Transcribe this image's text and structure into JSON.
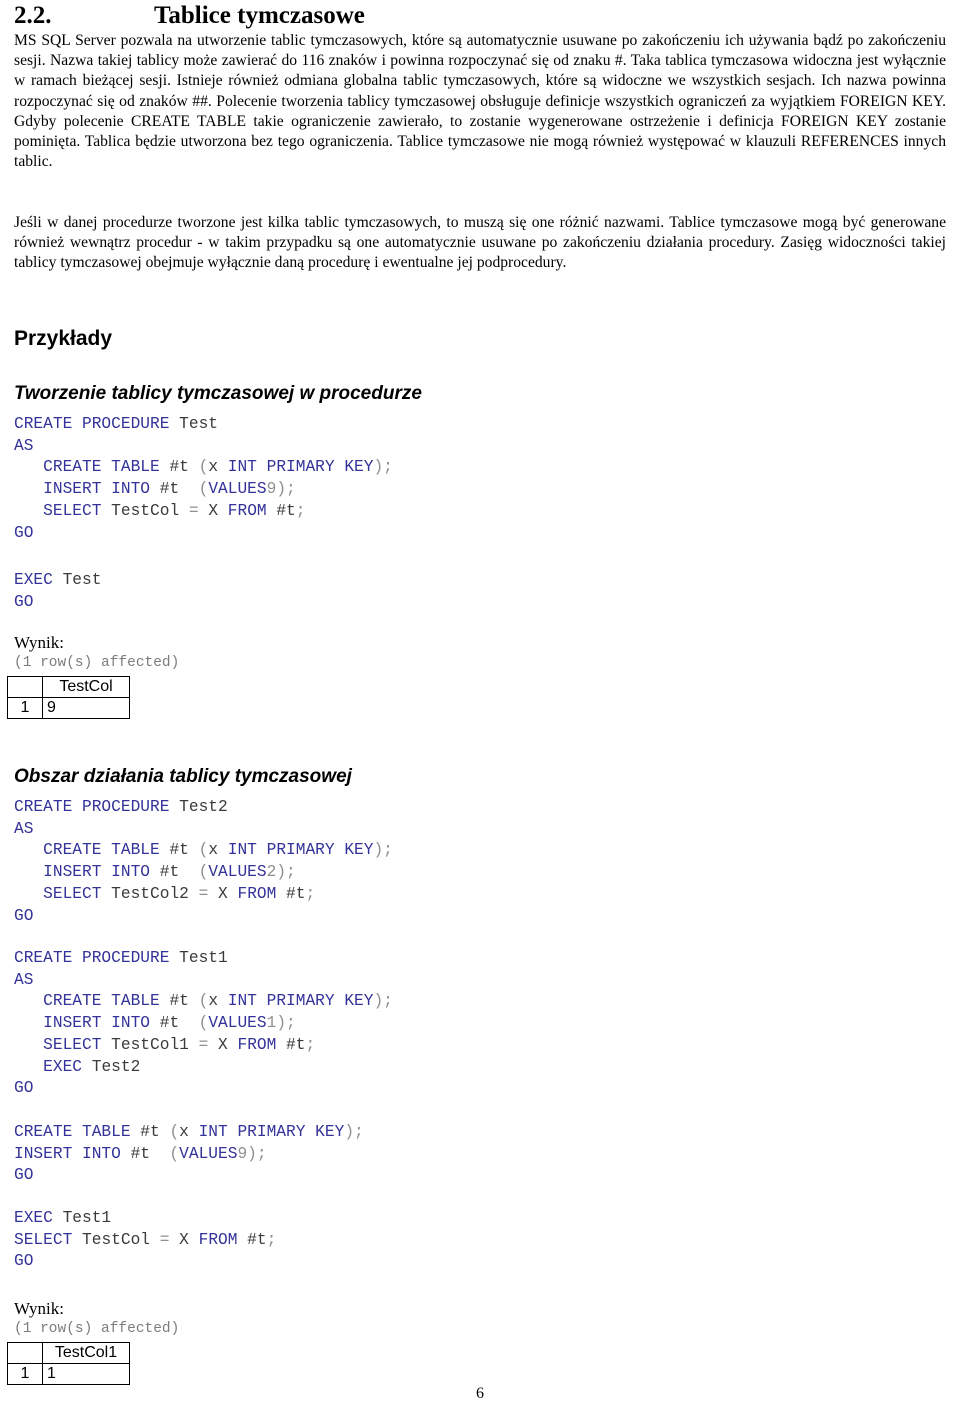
{
  "document": {
    "heading": {
      "number": "2.2.",
      "title": "Tablice tymczasowe"
    },
    "paragraphs": [
      "MS SQL Server pozwala na utworzenie tablic tymczasowych, które są automatycznie usuwane po zakończeniu ich używania bądź po zakończeniu sesji. Nazwa takiej tablicy może zawierać do 116 znaków i powinna rozpoczynać się od znaku #. Taka tablica tymczasowa widoczna jest wyłącznie w ramach bieżącej sesji. Istnieje również odmiana globalna tablic tymczasowych, które są widoczne we wszystkich sesjach. Ich nazwa powinna rozpoczynać się od znaków ##. Polecenie tworzenia tablicy tymczasowej obsługuje definicje wszystkich ograniczeń za wyjątkiem FOREIGN KEY. Gdyby polecenie CREATE TABLE takie ograniczenie zawierało, to zostanie wygenerowane ostrzeżenie i definicja FOREIGN KEY zostanie pominięta. Tablica będzie utworzona bez tego ograniczenia. Tablice tymczasowe nie mogą również występować w klauzuli REFERENCES innych tablic.",
      "Jeśli w danej procedurze tworzone jest kilka tablic tymczasowych, to muszą się one różnić nazwami. Tablice tymczasowe mogą być generowane również wewnątrz procedur - w takim przypadku są one automatycznie usuwane po zakończeniu działania procedury. Zasięg widoczności takiej tablicy tymczasowej obejmuje wyłącznie daną procedurę i ewentualne jej podprocedury."
    ],
    "examples_heading": "Przykłady",
    "sections": [
      {
        "title": "Tworzenie tablicy tymczasowej w procedurze"
      },
      {
        "title": "Obszar działania tablicy tymczasowej"
      }
    ],
    "code_blocks": {
      "block1": [
        {
          "kw": "CREATE PROCEDURE",
          "id": " Test"
        },
        {
          "kw": "AS",
          "id": ""
        },
        {
          "indent": "   ",
          "kw": "CREATE TABLE",
          "id": " #t ",
          "pun": "(",
          "id2": "x ",
          "kw2": "INT PRIMARY KEY",
          "pun2": ");"
        },
        {
          "indent": "   ",
          "kw": "INSERT INTO",
          "id": " #t ",
          "kw2": "VALUES",
          "pun": " (",
          "num": "9",
          "pun2": ");"
        },
        {
          "indent": "   ",
          "kw": "SELECT",
          "id": " TestCol ",
          "pun": "= ",
          "id2": "X ",
          "kw2": "FROM",
          "id3": " #t",
          "pun2": ";"
        },
        {
          "kw": "GO",
          "id": ""
        }
      ],
      "block2": [
        {
          "kw": "EXEC",
          "id": " Test"
        },
        {
          "kw": "GO",
          "id": ""
        }
      ],
      "block3": [
        {
          "kw": "CREATE PROCEDURE",
          "id": " Test2"
        },
        {
          "kw": "AS",
          "id": ""
        },
        {
          "indent": "   ",
          "kw": "CREATE TABLE",
          "id": " #t ",
          "pun": "(",
          "id2": "x ",
          "kw2": "INT PRIMARY KEY",
          "pun2": ");"
        },
        {
          "indent": "   ",
          "kw": "INSERT INTO",
          "id": " #t ",
          "kw2": "VALUES",
          "pun": " (",
          "num": "2",
          "pun2": ");"
        },
        {
          "indent": "   ",
          "kw": "SELECT",
          "id": " TestCol2 ",
          "pun": "= ",
          "id2": "X ",
          "kw2": "FROM",
          "id3": " #t",
          "pun2": ";"
        },
        {
          "kw": "GO",
          "id": ""
        }
      ],
      "block4": [
        {
          "kw": "CREATE PROCEDURE",
          "id": " Test1"
        },
        {
          "kw": "AS",
          "id": ""
        },
        {
          "indent": "   ",
          "kw": "CREATE TABLE",
          "id": " #t ",
          "pun": "(",
          "id2": "x ",
          "kw2": "INT PRIMARY KEY",
          "pun2": ");"
        },
        {
          "indent": "   ",
          "kw": "INSERT INTO",
          "id": " #t ",
          "kw2": "VALUES",
          "pun": " (",
          "num": "1",
          "pun2": ");"
        },
        {
          "indent": "   ",
          "kw": "SELECT",
          "id": " TestCol1 ",
          "pun": "= ",
          "id2": "X ",
          "kw2": "FROM",
          "id3": " #t",
          "pun2": ";"
        },
        {
          "indent": "   ",
          "kw": "EXEC",
          "id": " Test2"
        },
        {
          "kw": "GO",
          "id": ""
        }
      ],
      "block5": [
        {
          "kw": "CREATE TABLE",
          "id": " #t ",
          "pun": "(",
          "id2": "x ",
          "kw2": "INT PRIMARY KEY",
          "pun2": ");"
        },
        {
          "kw": "INSERT INTO",
          "id": " #t ",
          "kw2": "VALUES",
          "pun": " (",
          "num": "9",
          "pun2": ");"
        },
        {
          "kw": "GO",
          "id": ""
        }
      ],
      "block6": [
        {
          "kw": "EXEC",
          "id": " Test1"
        },
        {
          "kw": "SELECT",
          "id": " TestCol ",
          "pun": "= ",
          "id2": "X ",
          "kw2": "FROM",
          "id3": " #t",
          "pun2": ";"
        },
        {
          "kw": "GO",
          "id": ""
        }
      ]
    },
    "results": [
      {
        "label": "Wynik:",
        "affected": "(1 row(s) affected)",
        "header_index": "",
        "header_column": "TestCol",
        "row_index": "1",
        "row_value": "9"
      },
      {
        "label": "Wynik:",
        "affected": "(1 row(s) affected)",
        "header_index": "",
        "header_column": "TestCol1",
        "row_index": "1",
        "row_value": "1"
      }
    ],
    "page_number": "6"
  },
  "colors": {
    "keyword": "#333399",
    "identifier": "#3b3b3b",
    "punctuation": "#8f8f8f",
    "muted": "#7d7d7d",
    "text": "#000000"
  }
}
